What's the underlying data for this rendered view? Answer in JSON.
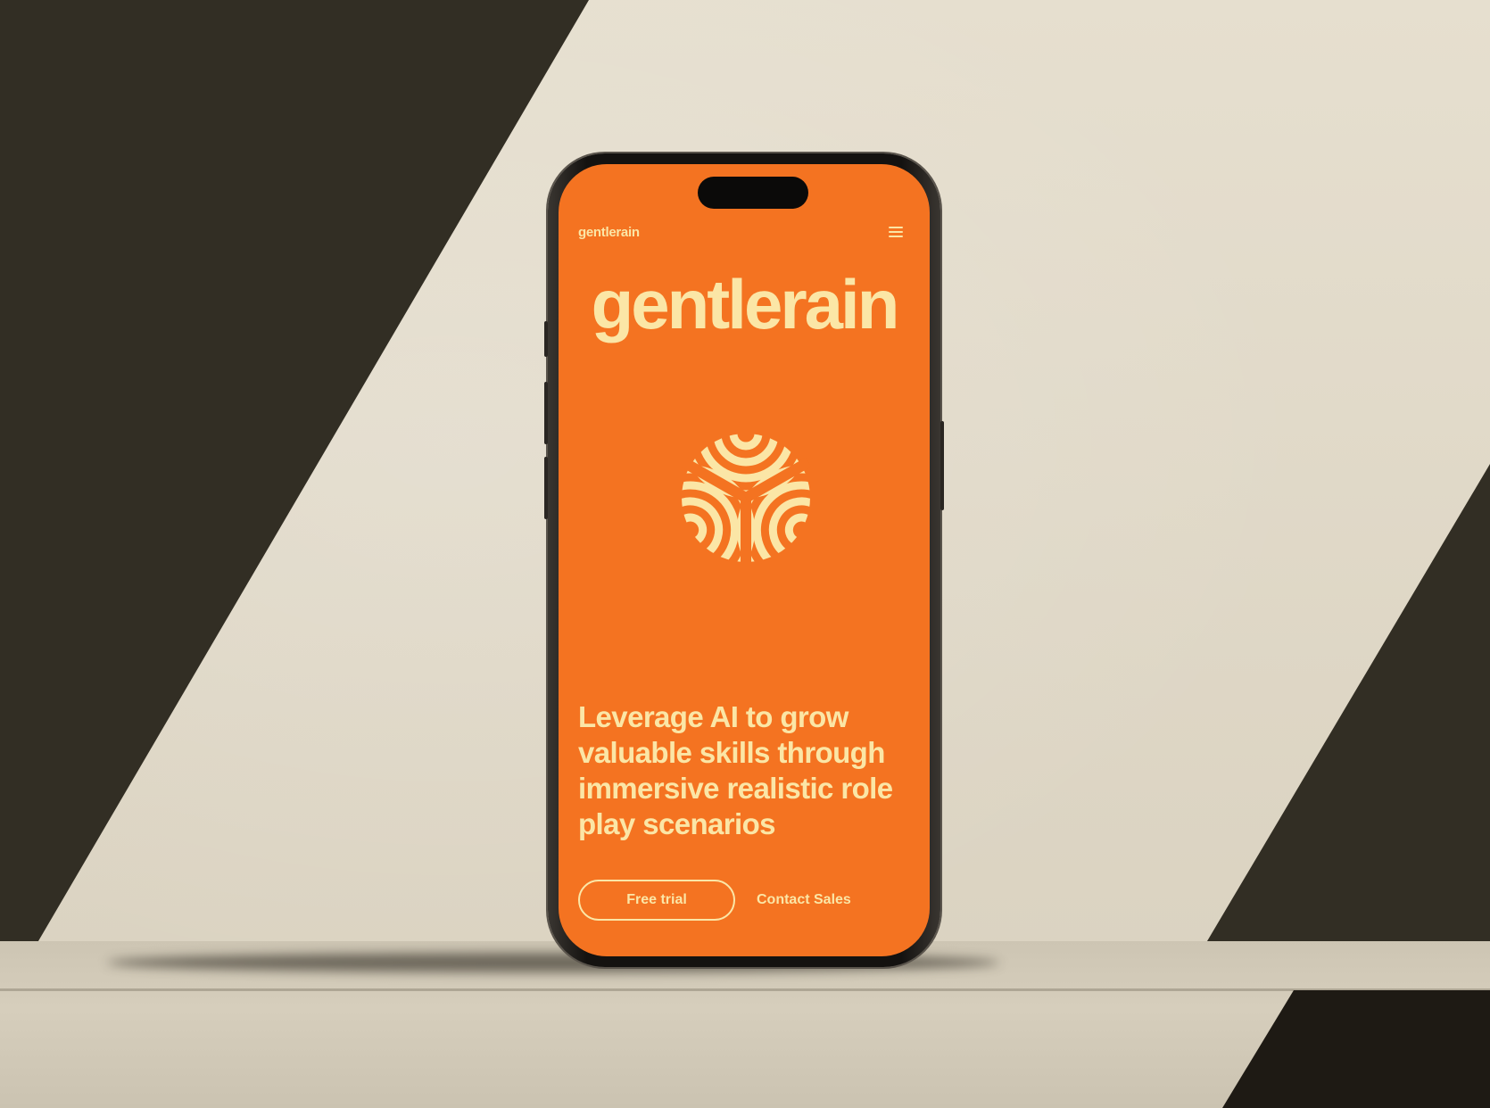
{
  "nav": {
    "brand": "gentlerain",
    "menu_icon": "hamburger-menu-icon"
  },
  "hero": {
    "title": "gentlerain",
    "logo_icon": "gentlerain-logo-mark",
    "tagline": "Leverage AI to grow valuable skills through immersive realistic role play scenarios"
  },
  "actions": {
    "free_trial_label": "Free trial",
    "contact_sales_label": "Contact Sales"
  },
  "colors": {
    "brand_orange": "#f47321",
    "brand_cream": "#fbe6a6"
  }
}
